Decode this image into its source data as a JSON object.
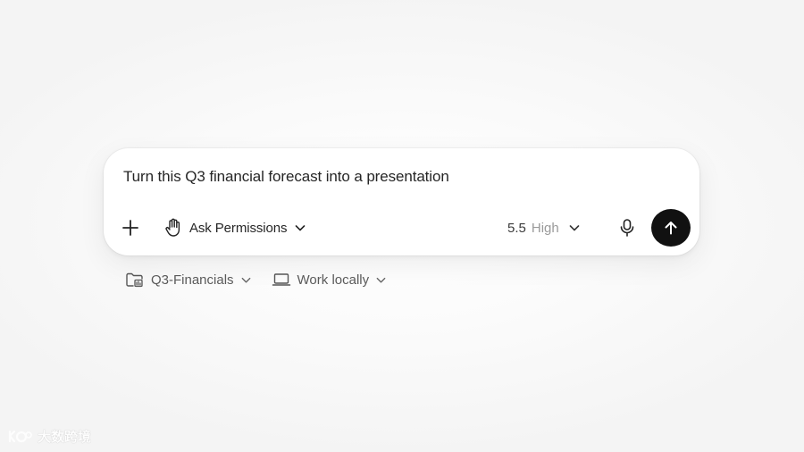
{
  "composer": {
    "prompt_text": "Turn this Q3 financial forecast into a presentation",
    "toolbar": {
      "add_icon": "plus-icon",
      "permissions_icon": "hand-icon",
      "permissions_label": "Ask Permissions",
      "model_version": "5.5",
      "model_level": "High",
      "mic_icon": "microphone-icon",
      "send_icon": "arrow-up-icon"
    }
  },
  "options": {
    "project_icon": "folder-icon",
    "project_label": "Q3-Financials",
    "environment_icon": "laptop-icon",
    "environment_label": "Work locally"
  },
  "watermark": {
    "text": "大数跨境"
  },
  "colors": {
    "background": "#f6f6f6",
    "card": "#ffffff",
    "send_button": "#111111",
    "muted_text": "#9a9a9a"
  }
}
